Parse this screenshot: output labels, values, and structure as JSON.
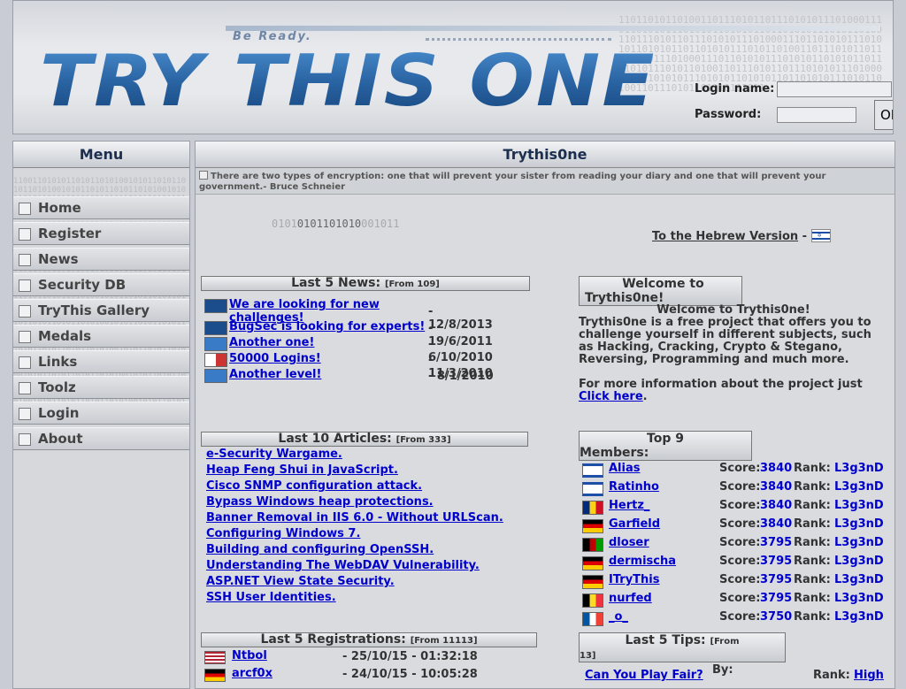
{
  "header": {
    "tagline": "Be Ready.",
    "logo_text": "TRY THIS ONE",
    "binary_bg": "1101101011010011011101011011101010111010001110110101011101010110101011011010101110101101001101110101101110101011101000111011010101110101011010101101101010111010110100110111010110111010101110100011101101010111010101101010110110101011101011010011011101011011101010111010001110110101011101010110101011011010101110101101001101110101101110101011",
    "login": {
      "username_label": "Login name:",
      "password_label": "Password:",
      "username_value": "",
      "password_value": "",
      "ok_label": "OK"
    }
  },
  "sidebar": {
    "title": "Menu",
    "binary_bg": "11001101010110101101010010101101011010110101001010110101101011010100101011010110101101010010101101011010110101001010110101101011010100101011010110101101010010101101011010110101001010110101101011010100101011010110101101010010101101011010110101001010110101101011010100101011010110101101010010101101011010110101001010110101101011010100101011010110101101010010101101011010110101001010110101101011010100101011010110101101010010101101011010110101001010110101101011010100101011010110101101010010101101011010110101001010110101101011010100101011010110101101010010101101011010110101001010110101101011010100101011010110101101010010101101011010110101001010110101101011010100101011010110101101010010101101011010110101001010110101101011010100101011010110101101010010101101011010110101001010110101101011010100101011010110101101010010101101011010110101001010110101101011010100101011010110101101010010101101011010110101001010110101101011010100101011010110101101010010101101011010110101001",
    "items": [
      {
        "label": "Home"
      },
      {
        "label": "Register"
      },
      {
        "label": "News"
      },
      {
        "label": "Security DB"
      },
      {
        "label": "TryThis Gallery"
      },
      {
        "label": "Medals"
      },
      {
        "label": "Links"
      },
      {
        "label": "Toolz"
      },
      {
        "label": "Login"
      },
      {
        "label": "About"
      }
    ]
  },
  "main": {
    "title": "Trythis0ne",
    "quote": "There are two types of encryption: one that will prevent your sister from reading your diary and one that will prevent your government.- Bruce Schneier",
    "ticker_dim": "0101",
    "ticker_bright": "0101101010",
    "ticker_dim2": "001011",
    "hebrew_link": "To the Hebrew Version",
    "hebrew_sep": " - ",
    "news": {
      "title": "Last 5 News:",
      "count": "[From 109]",
      "items": [
        {
          "title": "We are looking for new challenges!",
          "date": "- 12/8/2013",
          "icon": "globe-icon"
        },
        {
          "title": "BugSec is looking for experts!",
          "date": "- 19/6/2011",
          "icon": "globe-icon"
        },
        {
          "title": "Another one!",
          "date": "- 6/10/2010",
          "icon": "tto-icon"
        },
        {
          "title": "50000 Logins!",
          "date": "- 11/3/2010",
          "icon": "login-icon"
        },
        {
          "title": "Another level!",
          "date": "- 8/1/2010",
          "icon": "tto-icon"
        }
      ]
    },
    "articles": {
      "title": "Last 10 Articles:",
      "count": "[From 333]",
      "items": [
        "e-Security Wargame.",
        "Heap Feng Shui in JavaScript.",
        "Cisco SNMP configuration attack.",
        "Bypass Windows heap protections.",
        "Banner Removal in IIS 6.0 - Without URLScan.",
        "Configuring Windows 7.",
        "Building and configuring OpenSSH.",
        "Understanding The WebDAV Vulnerability.",
        "ASP.NET View State Security.",
        "SSH User Identities."
      ]
    },
    "registrations": {
      "title": "Last 5 Registrations:",
      "count": "[From 11113]",
      "items": [
        {
          "name": "Ntbol",
          "date": "- 25/10/15 - 01:32:18",
          "flag": "us"
        },
        {
          "name": "arcf0x",
          "date": "- 24/10/15 - 10:05:28",
          "flag": "de"
        }
      ]
    },
    "welcome": {
      "title_line1": "Welcome to",
      "title_line2": "Trythis0ne!",
      "subtitle": "Welcome to Trythis0ne!",
      "body": "Trythis0ne is a free project that offers you to challenge yourself in different subjects, such as Hacking, Cracking, Crypto & Stegano, Reversing, Programming and much more.",
      "more_prefix": "For more information about the project just",
      "more_link": "Click here",
      "more_suffix": "."
    },
    "members": {
      "title_line1": "Top 9",
      "title_line2": "Members:",
      "score_label": "Score:",
      "rank_label": "Rank:",
      "items": [
        {
          "name": "Alias",
          "score": "3840",
          "rank": "L3g3nD",
          "flag": "il"
        },
        {
          "name": "Ratinho",
          "score": "3840",
          "rank": "L3g3nD",
          "flag": "il"
        },
        {
          "name": "Hertz_",
          "score": "3840",
          "rank": "L3g3nD",
          "flag": "ro"
        },
        {
          "name": "Garfield",
          "score": "3840",
          "rank": "L3g3nD",
          "flag": "de"
        },
        {
          "name": "dloser",
          "score": "3795",
          "rank": "L3g3nD",
          "flag": "af"
        },
        {
          "name": "dermischa",
          "score": "3795",
          "rank": "L3g3nD",
          "flag": "de"
        },
        {
          "name": "ITryThis",
          "score": "3795",
          "rank": "L3g3nD",
          "flag": "de"
        },
        {
          "name": "nurfed",
          "score": "3795",
          "rank": "L3g3nD",
          "flag": "be"
        },
        {
          "name": "_o_",
          "score": "3750",
          "rank": "L3g3nD",
          "flag": "fr"
        }
      ]
    },
    "tips": {
      "title": "Last 5 Tips:",
      "count_a": "[From",
      "count_b": "13]",
      "first_tip": "Can You Play Fair?",
      "by_label": "By:",
      "rank_label": "Rank:",
      "rank_value": "High"
    }
  },
  "colors": {
    "link": "#0000cc",
    "header_title": "#1c2f4e",
    "logo_blue": "#2f6aa8"
  }
}
